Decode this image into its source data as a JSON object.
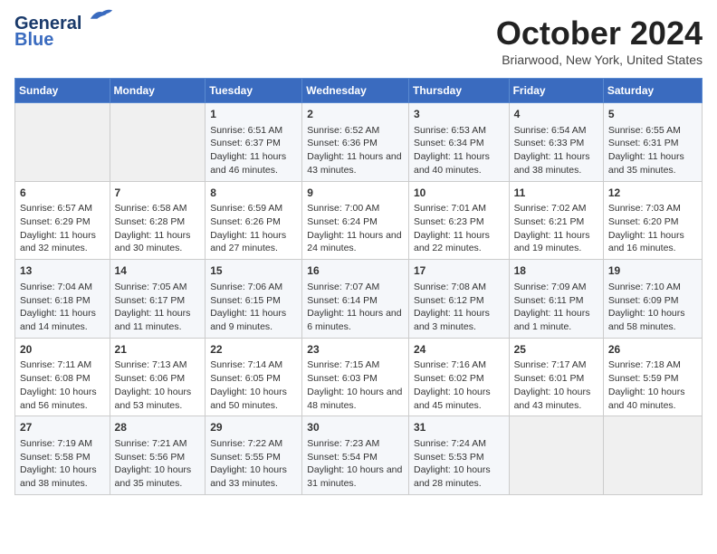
{
  "logo": {
    "line1": "General",
    "line2": "Blue"
  },
  "title": "October 2024",
  "location": "Briarwood, New York, United States",
  "days_of_week": [
    "Sunday",
    "Monday",
    "Tuesday",
    "Wednesday",
    "Thursday",
    "Friday",
    "Saturday"
  ],
  "weeks": [
    [
      {
        "num": "",
        "info": ""
      },
      {
        "num": "",
        "info": ""
      },
      {
        "num": "1",
        "info": "Sunrise: 6:51 AM\nSunset: 6:37 PM\nDaylight: 11 hours and 46 minutes."
      },
      {
        "num": "2",
        "info": "Sunrise: 6:52 AM\nSunset: 6:36 PM\nDaylight: 11 hours and 43 minutes."
      },
      {
        "num": "3",
        "info": "Sunrise: 6:53 AM\nSunset: 6:34 PM\nDaylight: 11 hours and 40 minutes."
      },
      {
        "num": "4",
        "info": "Sunrise: 6:54 AM\nSunset: 6:33 PM\nDaylight: 11 hours and 38 minutes."
      },
      {
        "num": "5",
        "info": "Sunrise: 6:55 AM\nSunset: 6:31 PM\nDaylight: 11 hours and 35 minutes."
      }
    ],
    [
      {
        "num": "6",
        "info": "Sunrise: 6:57 AM\nSunset: 6:29 PM\nDaylight: 11 hours and 32 minutes."
      },
      {
        "num": "7",
        "info": "Sunrise: 6:58 AM\nSunset: 6:28 PM\nDaylight: 11 hours and 30 minutes."
      },
      {
        "num": "8",
        "info": "Sunrise: 6:59 AM\nSunset: 6:26 PM\nDaylight: 11 hours and 27 minutes."
      },
      {
        "num": "9",
        "info": "Sunrise: 7:00 AM\nSunset: 6:24 PM\nDaylight: 11 hours and 24 minutes."
      },
      {
        "num": "10",
        "info": "Sunrise: 7:01 AM\nSunset: 6:23 PM\nDaylight: 11 hours and 22 minutes."
      },
      {
        "num": "11",
        "info": "Sunrise: 7:02 AM\nSunset: 6:21 PM\nDaylight: 11 hours and 19 minutes."
      },
      {
        "num": "12",
        "info": "Sunrise: 7:03 AM\nSunset: 6:20 PM\nDaylight: 11 hours and 16 minutes."
      }
    ],
    [
      {
        "num": "13",
        "info": "Sunrise: 7:04 AM\nSunset: 6:18 PM\nDaylight: 11 hours and 14 minutes."
      },
      {
        "num": "14",
        "info": "Sunrise: 7:05 AM\nSunset: 6:17 PM\nDaylight: 11 hours and 11 minutes."
      },
      {
        "num": "15",
        "info": "Sunrise: 7:06 AM\nSunset: 6:15 PM\nDaylight: 11 hours and 9 minutes."
      },
      {
        "num": "16",
        "info": "Sunrise: 7:07 AM\nSunset: 6:14 PM\nDaylight: 11 hours and 6 minutes."
      },
      {
        "num": "17",
        "info": "Sunrise: 7:08 AM\nSunset: 6:12 PM\nDaylight: 11 hours and 3 minutes."
      },
      {
        "num": "18",
        "info": "Sunrise: 7:09 AM\nSunset: 6:11 PM\nDaylight: 11 hours and 1 minute."
      },
      {
        "num": "19",
        "info": "Sunrise: 7:10 AM\nSunset: 6:09 PM\nDaylight: 10 hours and 58 minutes."
      }
    ],
    [
      {
        "num": "20",
        "info": "Sunrise: 7:11 AM\nSunset: 6:08 PM\nDaylight: 10 hours and 56 minutes."
      },
      {
        "num": "21",
        "info": "Sunrise: 7:13 AM\nSunset: 6:06 PM\nDaylight: 10 hours and 53 minutes."
      },
      {
        "num": "22",
        "info": "Sunrise: 7:14 AM\nSunset: 6:05 PM\nDaylight: 10 hours and 50 minutes."
      },
      {
        "num": "23",
        "info": "Sunrise: 7:15 AM\nSunset: 6:03 PM\nDaylight: 10 hours and 48 minutes."
      },
      {
        "num": "24",
        "info": "Sunrise: 7:16 AM\nSunset: 6:02 PM\nDaylight: 10 hours and 45 minutes."
      },
      {
        "num": "25",
        "info": "Sunrise: 7:17 AM\nSunset: 6:01 PM\nDaylight: 10 hours and 43 minutes."
      },
      {
        "num": "26",
        "info": "Sunrise: 7:18 AM\nSunset: 5:59 PM\nDaylight: 10 hours and 40 minutes."
      }
    ],
    [
      {
        "num": "27",
        "info": "Sunrise: 7:19 AM\nSunset: 5:58 PM\nDaylight: 10 hours and 38 minutes."
      },
      {
        "num": "28",
        "info": "Sunrise: 7:21 AM\nSunset: 5:56 PM\nDaylight: 10 hours and 35 minutes."
      },
      {
        "num": "29",
        "info": "Sunrise: 7:22 AM\nSunset: 5:55 PM\nDaylight: 10 hours and 33 minutes."
      },
      {
        "num": "30",
        "info": "Sunrise: 7:23 AM\nSunset: 5:54 PM\nDaylight: 10 hours and 31 minutes."
      },
      {
        "num": "31",
        "info": "Sunrise: 7:24 AM\nSunset: 5:53 PM\nDaylight: 10 hours and 28 minutes."
      },
      {
        "num": "",
        "info": ""
      },
      {
        "num": "",
        "info": ""
      }
    ]
  ]
}
